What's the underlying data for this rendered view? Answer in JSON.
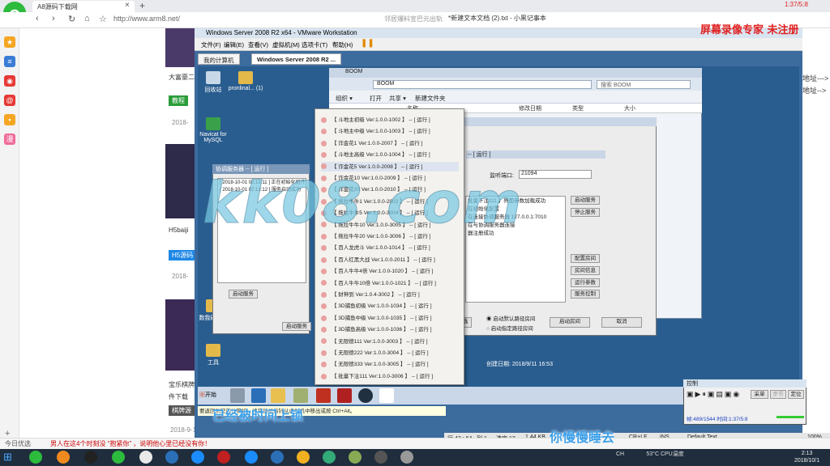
{
  "browser": {
    "logo": "e",
    "tab_title": "A8源码下载网",
    "address": "http://www.arm8.net/",
    "toolbar_extra": "邻居爆料宣巴元出轨"
  },
  "web": {
    "card1_title": "大富豪二",
    "card1_tag": "教程",
    "card1_date": "2018-",
    "card2_title": "H5baiji",
    "card2_tag": "H5源码",
    "card2_date": "2018-",
    "card3_title": "宝乐棋牌",
    "card3_sub": "件下载",
    "card3_tag": "棋牌源",
    "date_a": "2018-9-16",
    "likes_a": "2",
    "comments_a": "10",
    "date_b": "2018-9-16",
    "likes_b": "0",
    "comments_b": "17",
    "status_left": "今日优选",
    "status_news": "男人在这4个时刻没 “抱紧你” ，说明他心里已经没有你！"
  },
  "vmware": {
    "title": "Windows Server 2008 R2 x64 - VMware Workstation",
    "menu": [
      "文件(F)",
      "编辑(E)",
      "查看(V)",
      "虚拟机(M)",
      "选项卡(T)",
      "帮助(H)"
    ],
    "tabs": [
      "我的计算机",
      "Windows Server 2008 R2 ..."
    ],
    "hint": "要返回到您的计算机，请将鼠标指针从虚拟机中移出或按 Ctrl+Alt。"
  },
  "desktop_icons": [
    "回收站",
    "pronlinal... (1)",
    "Navicat for MySQL",
    "数我确外部",
    "工具"
  ],
  "explorer": {
    "title": "BOOM",
    "path": "BOOM",
    "search": "搜索 BOOM",
    "toolbar": [
      "组织 ▾",
      "打开",
      "共享 ▾",
      "新建文件夹"
    ],
    "columns": [
      "名称",
      "修改日期",
      "类型",
      "大小"
    ],
    "created": "创建日期: 2018/9/11 16:53"
  },
  "server_dialog": {
    "title": "-- [ 运行 ]",
    "port_label": "监听端口:",
    "port_value": "21094",
    "log": [
      "批量下注111 】界面参数加载成功",
      "在初始化配置",
      "在连接协调服务器 127.0.0.1:7010",
      "在与协调服务器连接",
      "器注册成功"
    ],
    "buttons": [
      "启动服务",
      "停止服务",
      "配置房间",
      "房间信息",
      "运行参数",
      "服务控制"
    ],
    "radio1": "启动默认路径房间",
    "radio2": "启动指定路径房间",
    "btn_start_room": "启动房间",
    "btn_cancel": "取消",
    "btn_select": "选"
  },
  "coordinator": {
    "title": "协调服务器 -- [ 运行 ]",
    "log": [
      "[ 2018-10-01 02:13:11 ] 正在初始化组件...",
      "[ 2018-10-01 02:13:12 ] 服务启动成功"
    ],
    "btn_start": "启动服务",
    "btn_stop": "启动服务"
  },
  "game_list": [
    "【 斗地主初级 Ver:1.0.0-1002 】 -- [ 运行 ]",
    "【 斗地主中级 Ver:1.0.0-1003 】 -- [ 运行 ]",
    "【 诈金花1 Ver:1.0.0-2007 】 -- [ 运行 ]",
    "【 斗地主高级 Ver:1.0.0-1004 】 -- [ 运行 ]",
    "【 诈金花5 Ver:1.0.0-2008 】 -- [ 运行 ]",
    "【 诈金花10 Ver:1.0.0-2009 】 -- [ 运行 ]",
    "【 诈金花20 Ver:1.0.0-2010 】 -- [ 运行 ]",
    "【 拖拉牛牛1 Ver:1.0.0-2002 】 -- [ 运行 ]",
    "【 拖拉牛牛5 Ver:1.0.0-3004 】 -- [ 运行 ]",
    "【 拖拉牛牛10 Ver:1.0.0-3005 】 -- [ 运行 ]",
    "【 拖拉牛牛20 Ver:1.0.0-3006 】 -- [ 运行 ]",
    "【 百人龙虎斗 Ver:1.0.0-1014 】 -- [ 运行 ]",
    "【 百人红黑大战 Ver:1.0.0-2011 】 -- [ 运行 ]",
    "【 百人牛牛4倍 Ver:1.0.0-1020 】 -- [ 运行 ]",
    "【 百人牛牛10倍 Ver:1.0.0-1021 】 -- [ 运行 ]",
    "【 财神到 Ver:1.0.4-3002 】 -- [ 运行 ]",
    "【 3D捕鱼初级 Ver:1.0.0-1034 】 -- [ 运行 ]",
    "【 3D捕鱼中级 Ver:1.0.0-1035 】 -- [ 运行 ]",
    "【 3D捕鱼高级 Ver:1.0.0-1036 】 -- [ 运行 ]",
    "【 无限德111 Ver:1.0.0-3003 】 -- [ 运行 ]",
    "【 无限德222 Ver:1.0.0-3004 】 -- [ 运行 ]",
    "【 无限德333 Ver:1.0.0-3005 】 -- [ 运行 ]",
    "【 批量下注111 Ver:1.0.0-3006 】 -- [ 运行 ]"
  ],
  "vm_taskbar": {
    "start": "开始"
  },
  "notepad": {
    "title": "*新建文本文档 (2).txt - 小黑记事本",
    "status": [
      "行 43 : 64",
      "列 1",
      "选定 12",
      "1.44 KB",
      "CR+LF",
      "INS",
      "Default Text",
      "100%"
    ]
  },
  "recorder": {
    "brand": "屏幕录像专家 未注册",
    "time": "1:37/5:8",
    "ctrl_title": "控制",
    "ctrl_frame": "帧:489/1544 时间:1:37/5:8",
    "btn_capture": "采单",
    "btn_step": "步节",
    "btn_locate": "定位"
  },
  "right_text": [
    "地址--->",
    "地址-->"
  ],
  "overlays": {
    "watermark": "kk08.com",
    "sub1": "已经被时间上锁",
    "sub2": "你慢慢睡去"
  },
  "host_tray": {
    "weather": "53°C",
    "cpu": "CPU温度",
    "ime": "CH",
    "time": "2:13",
    "date": "2018/10/1"
  }
}
